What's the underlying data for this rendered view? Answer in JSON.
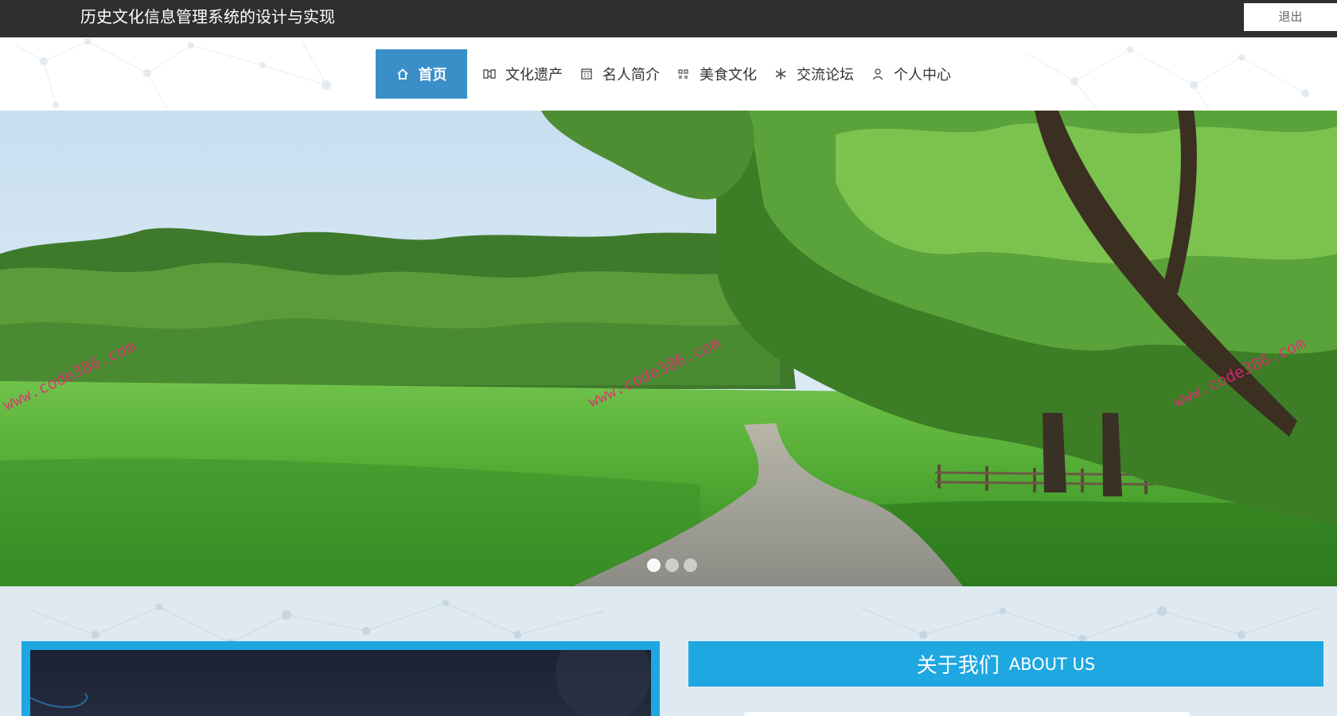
{
  "header": {
    "site_title": "历史文化信息管理系统的设计与实现",
    "logout_label": "退出"
  },
  "nav": {
    "items": [
      {
        "label": "首页",
        "icon": "home-icon",
        "active": true
      },
      {
        "label": "文化遗产",
        "icon": "book-icon",
        "active": false
      },
      {
        "label": "名人简介",
        "icon": "calendar-icon",
        "active": false
      },
      {
        "label": "美食文化",
        "icon": "grid-icon",
        "active": false
      },
      {
        "label": "交流论坛",
        "icon": "snowflake-icon",
        "active": false
      },
      {
        "label": "个人中心",
        "icon": "user-icon",
        "active": false
      }
    ]
  },
  "banner": {
    "watermarks": [
      "www.code386.com",
      "www.code386.com",
      "www.code386.com"
    ],
    "slide_count": 3,
    "active_slide": 1
  },
  "about": {
    "title_cn": "关于我们",
    "title_en": "ABOUT US"
  },
  "colors": {
    "topbar": "#2f2f2f",
    "nav_active": "#3a8fc8",
    "accent": "#1ea7e1",
    "section_bg": "#dfe9f1"
  }
}
